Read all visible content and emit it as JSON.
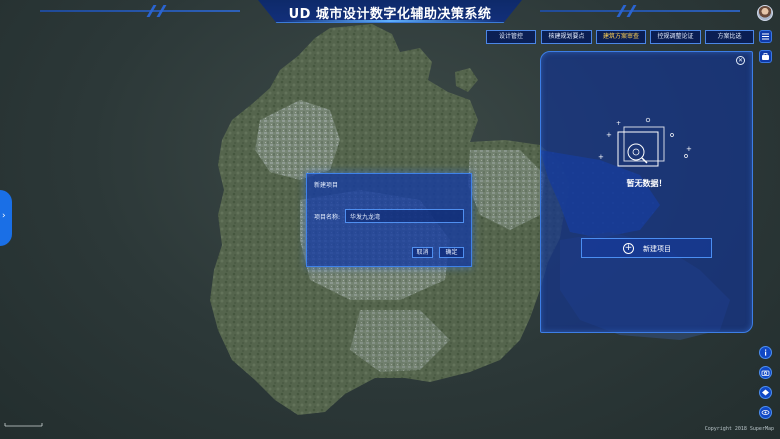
{
  "header": {
    "title": "UD 城市设计数字化辅助决策系统"
  },
  "tabs": [
    {
      "label": "设计管控",
      "active": false
    },
    {
      "label": "核建规划要点",
      "active": false
    },
    {
      "label": "建筑方案审查",
      "active": true
    },
    {
      "label": "控规调整论证",
      "active": false
    },
    {
      "label": "方案比选",
      "active": false
    }
  ],
  "colors": {
    "active_tab_text": "#ffd257",
    "panel_bg": "#15348c",
    "accent_blue": "#3d7ee6"
  },
  "panel": {
    "no_data_text": "暂无数据！",
    "new_project_label": "新建项目",
    "close_icon": "close-icon"
  },
  "dialog": {
    "title": "新建项目",
    "name_label": "项目名称:",
    "name_value": "华发九龙湾",
    "cancel_label": "取消",
    "confirm_label": "确定"
  },
  "icons": {
    "left_toggle": "chevron-right-icon",
    "right_top": [
      "list-icon",
      "briefcase-icon"
    ],
    "right_bottom": [
      "info-icon",
      "camera-icon",
      "layers-icon",
      "view-icon"
    ]
  },
  "footer": {
    "copyright": "Copyright 2018 SuperMap"
  }
}
